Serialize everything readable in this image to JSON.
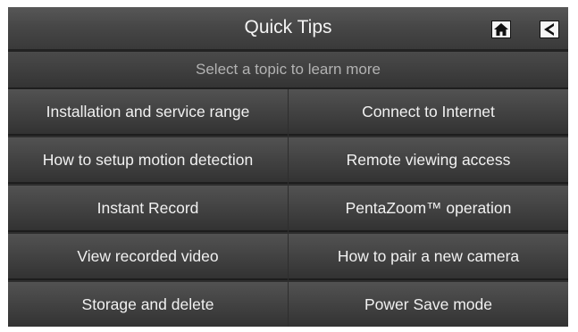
{
  "header": {
    "title": "Quick Tips",
    "home_icon": "home-icon",
    "back_icon": "back-arrow-icon"
  },
  "subheader": {
    "text": "Select a topic to learn more"
  },
  "topics": {
    "left": [
      "Installation and service range",
      "How to setup motion detection",
      "Instant Record",
      "View recorded video",
      "Storage and delete"
    ],
    "right": [
      "Connect to Internet",
      "Remote viewing access",
      "PentaZoom™ operation",
      "How to pair a new camera",
      "Power Save mode"
    ]
  },
  "colors": {
    "background": "#2e2e2e",
    "text": "#f1f1f1",
    "subheader_text": "#b2b2b2"
  }
}
